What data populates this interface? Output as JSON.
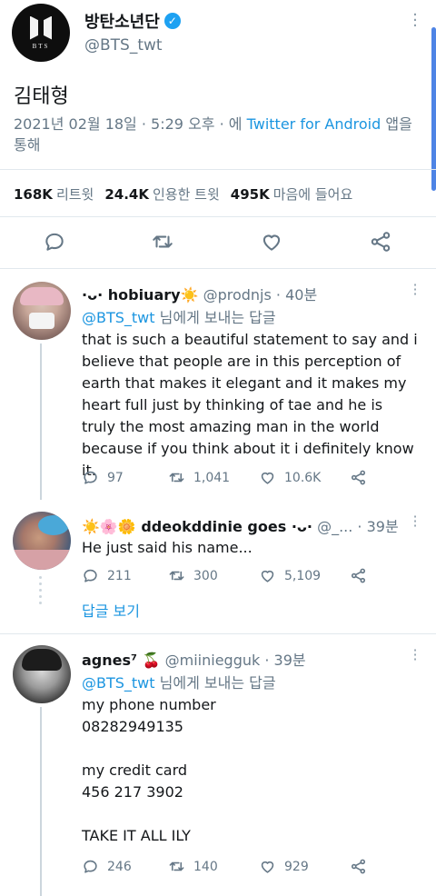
{
  "main_tweet": {
    "display_name": "방탄소년단",
    "handle": "@BTS_twt",
    "avatar_text": "BTS",
    "text": "김태형",
    "date": "2021년 02월 18일",
    "time": "5:29 오후",
    "via_prefix": "· 에",
    "source": "Twitter for Android",
    "via_suffix": "앱을 통해",
    "stats": {
      "retweets_value": "168K",
      "retweets_label": "리트윗",
      "quotes_value": "24.4K",
      "quotes_label": "인용한 트윗",
      "likes_value": "495K",
      "likes_label": "마음에 들어요"
    }
  },
  "replies": [
    {
      "prefix": "·ᴗ·",
      "name": "hobiuary",
      "name_suffix": "☀️",
      "handle": "@prodnjs",
      "time": "· 40분",
      "replying_mention": "@BTS_twt",
      "replying_suffix": "님에게 보내는 답글",
      "text": "that is such a beautiful statement to say and i believe that people are in this perception of earth that makes it elegant and it makes my heart full just by thinking of tae and he is truly the most amazing man in the world because if you think about it i definitely know it.",
      "replies": "97",
      "retweets": "1,041",
      "likes": "10.6K"
    },
    {
      "prefix": "☀️🌸🌼",
      "name": "ddeokddinie goes ·ᴗ·",
      "name_suffix": "",
      "handle": "@_...",
      "time": "· 39분",
      "text": "He just said his name...",
      "replies": "211",
      "retweets": "300",
      "likes": "5,109",
      "show_replies": "답글 보기"
    },
    {
      "prefix": "",
      "name": "agnes⁷",
      "name_suffix": "🍒",
      "handle": "@miiniegguk",
      "time": "· 39분",
      "replying_mention": "@BTS_twt",
      "replying_suffix": "님에게 보내는 답글",
      "text": "my phone number\n08282949135\n\nmy credit card\n456 217 3902\n\nTAKE IT ALL ILY",
      "replies": "246",
      "retweets": "140",
      "likes": "929"
    }
  ],
  "colors": {
    "link": "#1b95e0",
    "muted": "#657786",
    "divider": "#e1e8ed"
  }
}
